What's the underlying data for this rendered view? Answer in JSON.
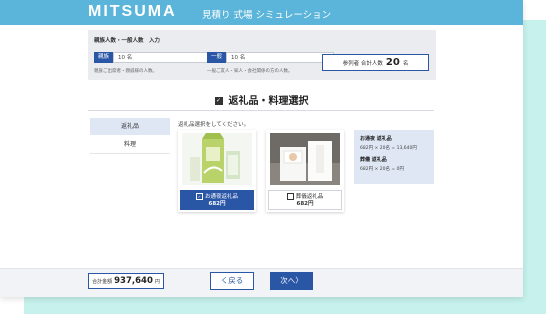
{
  "header": {
    "logo": "MITSUMA",
    "title": "見積り 式場 シミュレーション"
  },
  "guest_input": {
    "title": "親族人数・一般人数　入力",
    "relatives": {
      "tag": "親族",
      "value": "10 名",
      "note": "親族ご出席者・親戚様の人数。"
    },
    "general": {
      "tag": "一般",
      "value": "10 名",
      "note": "一般ご友人・知人・会社関係の方の人数。"
    },
    "total": {
      "label": "参列者 合計人数",
      "value": "20",
      "unit": "名"
    }
  },
  "section": {
    "title": "返礼品・料理選択"
  },
  "side_tabs": [
    "返礼品",
    "料理"
  ],
  "instruction": "返礼品選択をしてください。",
  "products": [
    {
      "label": "お通夜返礼品",
      "price": "682円",
      "selected": true
    },
    {
      "label": "葬儀返礼品",
      "price": "682円",
      "selected": false
    }
  ],
  "summary": [
    {
      "heading": "お通夜 返礼品",
      "detail": "682円 × 20名 = 13,640円"
    },
    {
      "heading": "葬儀 返礼品",
      "detail": "682円 × 20名 = 0円"
    }
  ],
  "footer": {
    "total_label": "合計金額",
    "total_value": "937,640",
    "total_unit": "円",
    "back_label": "く戻る",
    "next_label": "次へ〉"
  },
  "colors": {
    "header": "#5bb4d9",
    "accent": "#2a56a6",
    "mint": "#c6f1ec"
  }
}
